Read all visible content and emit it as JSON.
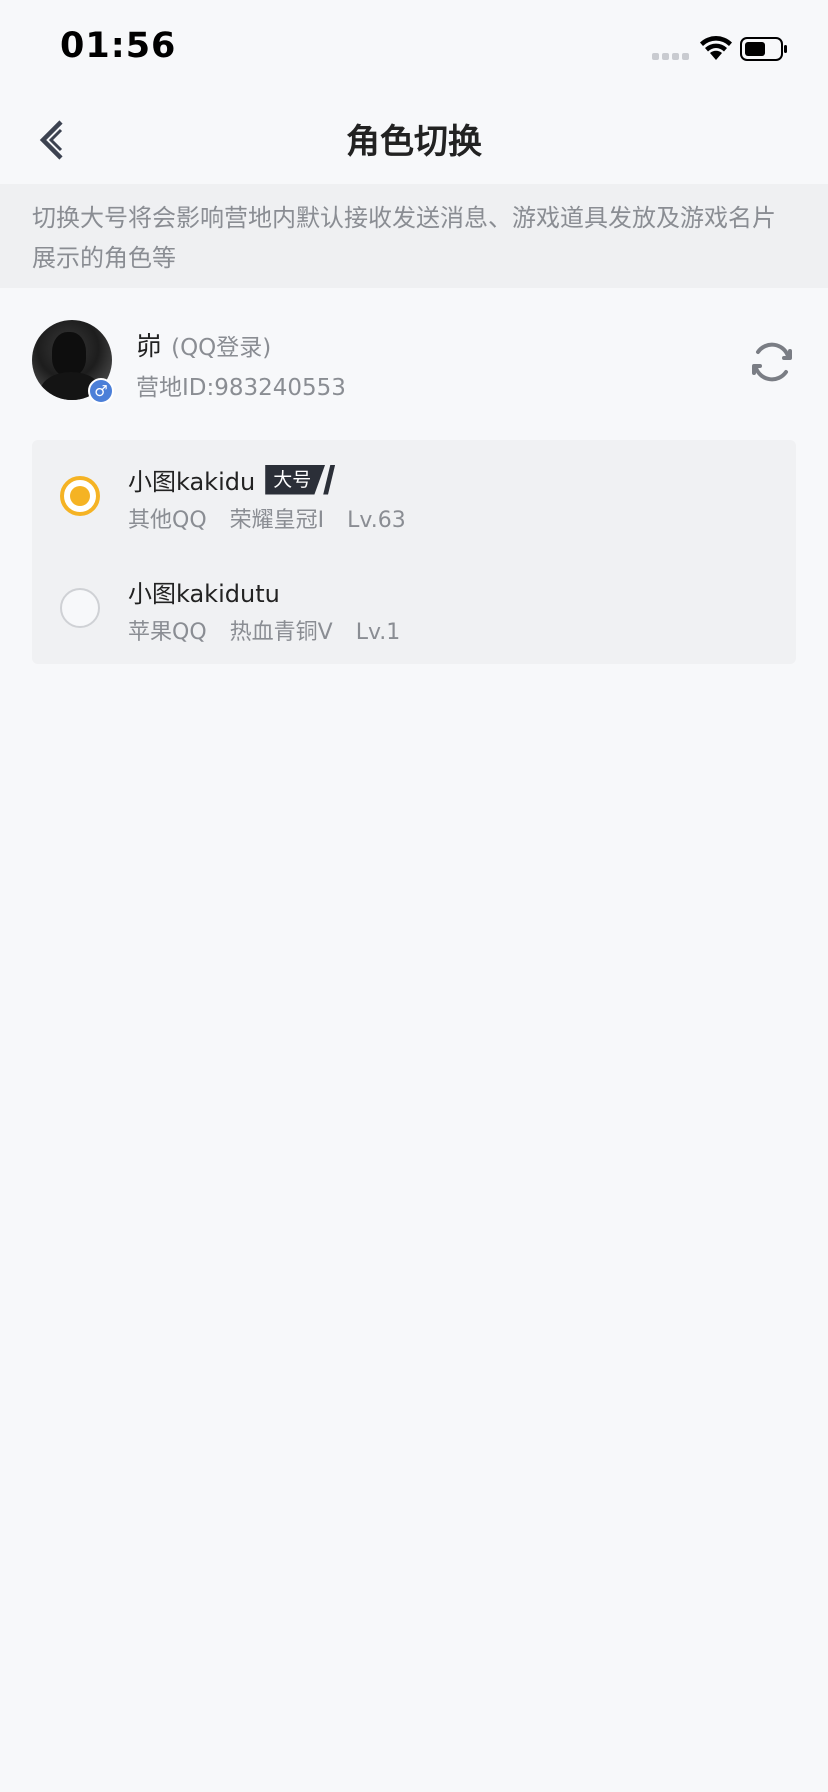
{
  "status_bar": {
    "time": "01:56"
  },
  "header": {
    "title": "角色切换"
  },
  "notice": {
    "text": "切换大号将会影响营地内默认接收发送消息、游戏道具发放及游戏名片展示的角色等"
  },
  "account": {
    "name": "峁",
    "login_type": "(QQ登录)",
    "camp_id": "营地ID:983240553",
    "gender_symbol": "♂"
  },
  "roles": [
    {
      "name": "小图kakidu",
      "badge": "大号",
      "platform": "其他QQ",
      "rank": "荣耀皇冠I",
      "level": "Lv.63",
      "selected": true
    },
    {
      "name": "小图kakidutu",
      "platform": "苹果QQ",
      "rank": "热血青铜V",
      "level": "Lv.1",
      "selected": false
    }
  ],
  "colors": {
    "accent": "#f5b324",
    "background": "#f7f8fa",
    "notice_bg": "#eff0f2",
    "secondary_text": "#8a8d93"
  },
  "icons": {
    "back": "chevron-left-icon",
    "refresh": "refresh-icon",
    "wifi": "wifi-icon",
    "battery": "battery-icon"
  }
}
